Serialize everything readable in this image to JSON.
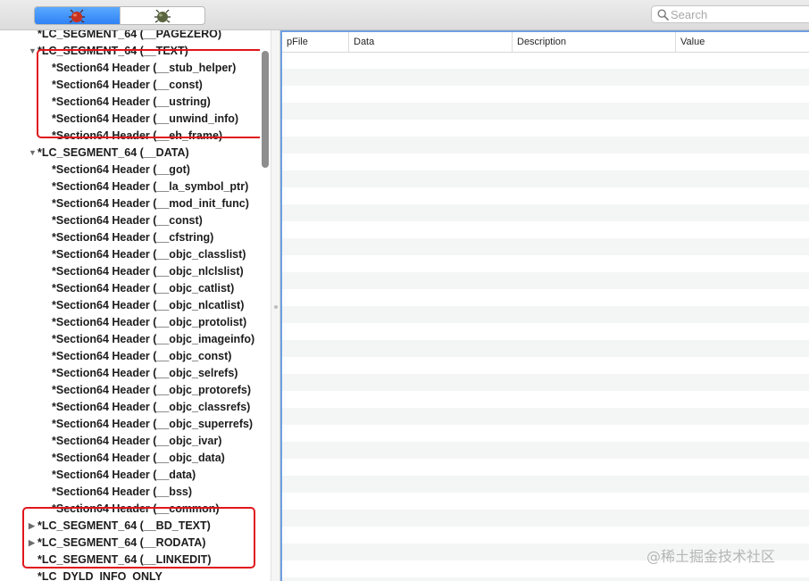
{
  "toolbar": {
    "view_buttons": [
      {
        "name": "raw-view",
        "icon": "red-bug-icon",
        "active": true
      },
      {
        "name": "rva-view",
        "icon": "green-bug-icon",
        "active": false
      }
    ],
    "search": {
      "placeholder": "Search",
      "value": ""
    }
  },
  "tree": {
    "rows": [
      {
        "label": "*LC_SEGMENT_64 (__PAGEZERO)",
        "indent": 0,
        "disclosure": "none"
      },
      {
        "label": "*LC_SEGMENT_64 (__TEXT)",
        "indent": 0,
        "disclosure": "open"
      },
      {
        "label": "*Section64 Header (__stub_helper)",
        "indent": 1,
        "disclosure": "none"
      },
      {
        "label": "*Section64 Header (__const)",
        "indent": 1,
        "disclosure": "none"
      },
      {
        "label": "*Section64 Header (__ustring)",
        "indent": 1,
        "disclosure": "none"
      },
      {
        "label": "*Section64 Header (__unwind_info)",
        "indent": 1,
        "disclosure": "none"
      },
      {
        "label": "*Section64 Header (__eh_frame)",
        "indent": 1,
        "disclosure": "none"
      },
      {
        "label": "*LC_SEGMENT_64 (__DATA)",
        "indent": 0,
        "disclosure": "open"
      },
      {
        "label": "*Section64 Header (__got)",
        "indent": 1,
        "disclosure": "none"
      },
      {
        "label": "*Section64 Header (__la_symbol_ptr)",
        "indent": 1,
        "disclosure": "none"
      },
      {
        "label": "*Section64 Header (__mod_init_func)",
        "indent": 1,
        "disclosure": "none"
      },
      {
        "label": "*Section64 Header (__const)",
        "indent": 1,
        "disclosure": "none"
      },
      {
        "label": "*Section64 Header (__cfstring)",
        "indent": 1,
        "disclosure": "none"
      },
      {
        "label": "*Section64 Header (__objc_classlist)",
        "indent": 1,
        "disclosure": "none"
      },
      {
        "label": "*Section64 Header (__objc_nlclslist)",
        "indent": 1,
        "disclosure": "none"
      },
      {
        "label": "*Section64 Header (__objc_catlist)",
        "indent": 1,
        "disclosure": "none"
      },
      {
        "label": "*Section64 Header (__objc_nlcatlist)",
        "indent": 1,
        "disclosure": "none"
      },
      {
        "label": "*Section64 Header (__objc_protolist)",
        "indent": 1,
        "disclosure": "none"
      },
      {
        "label": "*Section64 Header (__objc_imageinfo)",
        "indent": 1,
        "disclosure": "none"
      },
      {
        "label": "*Section64 Header (__objc_const)",
        "indent": 1,
        "disclosure": "none"
      },
      {
        "label": "*Section64 Header (__objc_selrefs)",
        "indent": 1,
        "disclosure": "none"
      },
      {
        "label": "*Section64 Header (__objc_protorefs)",
        "indent": 1,
        "disclosure": "none"
      },
      {
        "label": "*Section64 Header (__objc_classrefs)",
        "indent": 1,
        "disclosure": "none"
      },
      {
        "label": "*Section64 Header (__objc_superrefs)",
        "indent": 1,
        "disclosure": "none"
      },
      {
        "label": "*Section64 Header (__objc_ivar)",
        "indent": 1,
        "disclosure": "none"
      },
      {
        "label": "*Section64 Header (__objc_data)",
        "indent": 1,
        "disclosure": "none"
      },
      {
        "label": "*Section64 Header (__data)",
        "indent": 1,
        "disclosure": "none"
      },
      {
        "label": "*Section64 Header (__bss)",
        "indent": 1,
        "disclosure": "none"
      },
      {
        "label": "*Section64 Header (__common)",
        "indent": 1,
        "disclosure": "none"
      },
      {
        "label": "*LC_SEGMENT_64 (__BD_TEXT)",
        "indent": 0,
        "disclosure": "closed"
      },
      {
        "label": "*LC_SEGMENT_64 (__RODATA)",
        "indent": 0,
        "disclosure": "closed"
      },
      {
        "label": "*LC_SEGMENT_64 (__LINKEDIT)",
        "indent": 0,
        "disclosure": "none"
      },
      {
        "label": "*LC_DYLD_INFO_ONLY",
        "indent": 0,
        "disclosure": "none"
      }
    ]
  },
  "table": {
    "columns": [
      "pFile",
      "Data",
      "Description",
      "Value"
    ],
    "rows": []
  },
  "watermark": "@稀土掘金技术社区",
  "colors": {
    "highlight_box": "#e0161c",
    "table_focus_border": "#6e9fe0",
    "segmented_active": "#2f82f5",
    "row_stripe": "#f4f5f5"
  }
}
